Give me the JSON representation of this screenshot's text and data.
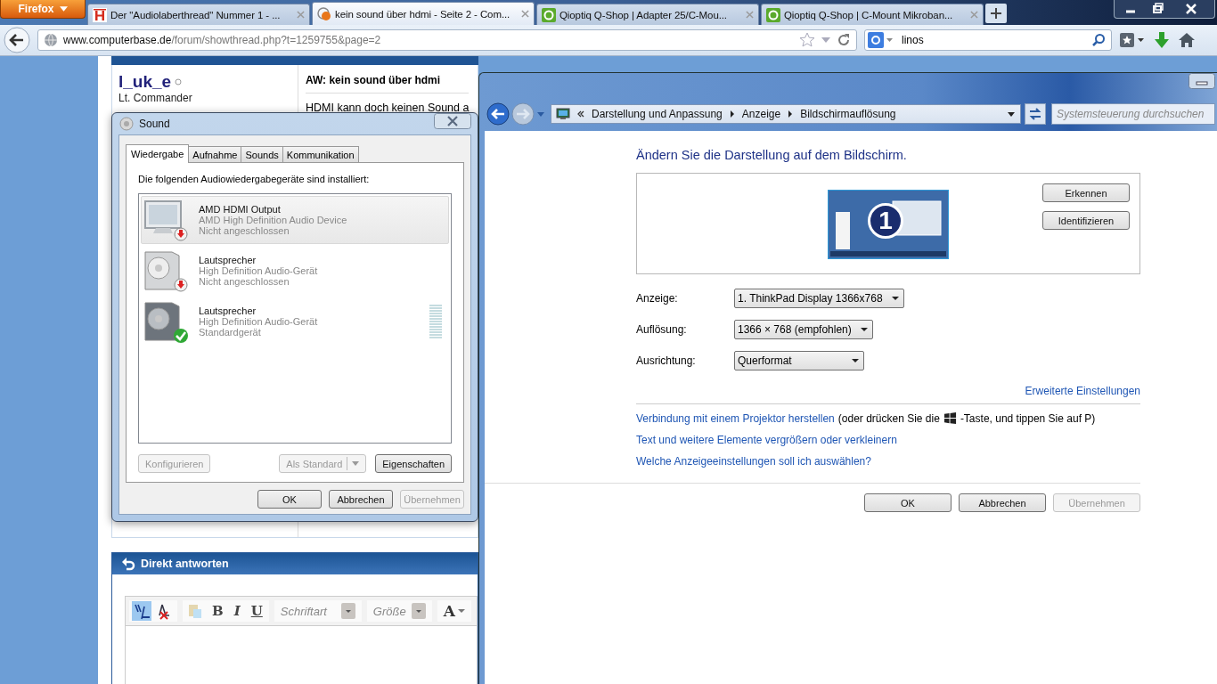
{
  "browser": {
    "menu_button": "Firefox",
    "tabs": [
      {
        "title": "Der \"Audiolaberthread\" Nummer 1 - ...",
        "kind": "hotel",
        "selected": false
      },
      {
        "title": "kein sound über hdmi - Seite 2 - Com...",
        "kind": "forum",
        "selected": true
      },
      {
        "title": "Qioptiq Q-Shop | Adapter 25/C-Mou...",
        "kind": "shop",
        "selected": false
      },
      {
        "title": "Qioptiq Q-Shop | C-Mount Mikroban...",
        "kind": "shop",
        "selected": false
      }
    ],
    "address": {
      "host": "www.computerbase.de",
      "path": "/forum/showthread.php?t=1259755&page=2"
    },
    "search": {
      "value": "linos"
    }
  },
  "forum": {
    "post": {
      "username": "l_uk_e",
      "rank": "Lt. Commander",
      "title": "AW: kein sound über hdmi",
      "text": "HDMI kann doch keinen Sound a"
    },
    "reply": {
      "title": "Direkt antworten",
      "font_placeholder": "Schriftart",
      "size_placeholder": "Größe",
      "format_buttons": [
        "B",
        "I",
        "U"
      ],
      "color_button": "A"
    }
  },
  "sound_dialog": {
    "title": "Sound",
    "tabs": [
      {
        "label": "Wiedergabe",
        "selected": true
      },
      {
        "label": "Aufnahme",
        "selected": false
      },
      {
        "label": "Sounds",
        "selected": false
      },
      {
        "label": "Kommunikation",
        "selected": false
      }
    ],
    "instruction": "Die folgenden Audiowiedergabegeräte sind installiert:",
    "devices": [
      {
        "name": "AMD HDMI Output",
        "driver": "AMD High Definition Audio Device",
        "status": "Nicht angeschlossen",
        "kind": "monitor",
        "connected": false,
        "default": false,
        "selected": true
      },
      {
        "name": "Lautsprecher",
        "driver": "High Definition Audio-Gerät",
        "status": "Nicht angeschlossen",
        "kind": "speaker",
        "connected": false,
        "default": false,
        "selected": false
      },
      {
        "name": "Lautsprecher",
        "driver": "High Definition Audio-Gerät",
        "status": "Standardgerät",
        "kind": "speaker",
        "connected": true,
        "default": true,
        "selected": false
      }
    ],
    "list_buttons": [
      {
        "label": "Konfigurieren",
        "disabled": true
      },
      {
        "label": "Als Standard",
        "disabled": true,
        "dropdown": true
      },
      {
        "label": "Eigenschaften",
        "disabled": false
      }
    ],
    "buttons": [
      {
        "label": "OK",
        "disabled": false
      },
      {
        "label": "Abbrechen",
        "disabled": false
      },
      {
        "label": "Übernehmen",
        "disabled": true
      }
    ]
  },
  "display_window": {
    "breadcrumb": [
      "Darstellung und Anpassung",
      "Anzeige",
      "Bildschirmauflösung"
    ],
    "search": {
      "placeholder": "Systemsteuerung durchsuchen"
    },
    "heading": "Ändern Sie die Darstellung auf dem Bildschirm.",
    "monitor_number": "1",
    "monitor_buttons": [
      "Erkennen",
      "Identifizieren"
    ],
    "settings": [
      {
        "label": "Anzeige:",
        "value": "1. ThinkPad Display 1366x768"
      },
      {
        "label": "Auflösung:",
        "value": "1366 × 768 (empfohlen)"
      },
      {
        "label": "Ausrichtung:",
        "value": "Querformat"
      }
    ],
    "advanced_link": "Erweiterte Einstellungen",
    "projector": {
      "link": "Verbindung mit einem Projektor herstellen",
      "before_key": "(oder drücken Sie die",
      "after_key": "-Taste, und tippen Sie auf P)"
    },
    "links": [
      "Text und weitere Elemente vergrößern oder verkleinern",
      "Welche Anzeigeeinstellungen soll ich auswählen?"
    ],
    "buttons": [
      {
        "label": "OK",
        "disabled": false
      },
      {
        "label": "Abbrechen",
        "disabled": false
      },
      {
        "label": "Übernehmen",
        "disabled": true
      }
    ]
  }
}
